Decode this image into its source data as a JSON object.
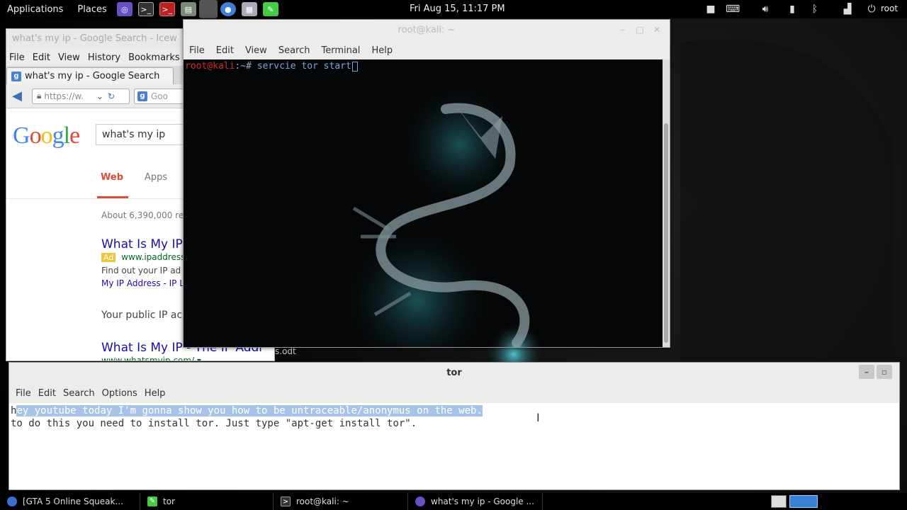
{
  "top_panel": {
    "applications": "Applications",
    "places": "Places",
    "clock": "Fri Aug 15, 11:17 PM",
    "user": "root"
  },
  "browser": {
    "window_title": "what's my ip - Google Search - Icew",
    "menu": [
      "File",
      "Edit",
      "View",
      "History",
      "Bookmarks"
    ],
    "tab_label": "what's my ip - Google Search",
    "url": "https://w.",
    "search_engine_placeholder": "Goo",
    "google_logo": "Google",
    "search_query": "what's my ip",
    "result_tabs": [
      "Web",
      "Apps"
    ],
    "result_count": "About 6,390,000 re",
    "result1_title": "What Is My IP",
    "result1_ad_label": "Ad",
    "result1_url": "www.ipaddress",
    "result1_snippet": "Find out your IP ad",
    "result1_link": "My IP Address - IP L",
    "public_ip_text": "Your public IP ac",
    "result2_title": "What Is My IP - The IP Addr",
    "result2_url": "www.whatsmyip.com/ ▾",
    "desktop_file": "s.odt"
  },
  "terminal": {
    "title": "root@kali: ~",
    "menu": [
      "File",
      "Edit",
      "View",
      "Search",
      "Terminal",
      "Help"
    ],
    "prompt_user": "root@kali",
    "prompt_rest": ":~# ",
    "command": "servcie tor start"
  },
  "editor": {
    "title": "tor",
    "menu": [
      "File",
      "Edit",
      "Search",
      "Options",
      "Help"
    ],
    "line1_first": "h",
    "line1_selected": "ey youtube today I'm gonna show you how to be untraceable/anonymus on the web.",
    "line2": "to do this you need to install tor. Just type \"apt-get install tor\"."
  },
  "taskbar": {
    "tasks": [
      "[GTA 5 Online Squeak...",
      "tor",
      "root@kali: ~",
      "what's my ip - Google ..."
    ]
  }
}
